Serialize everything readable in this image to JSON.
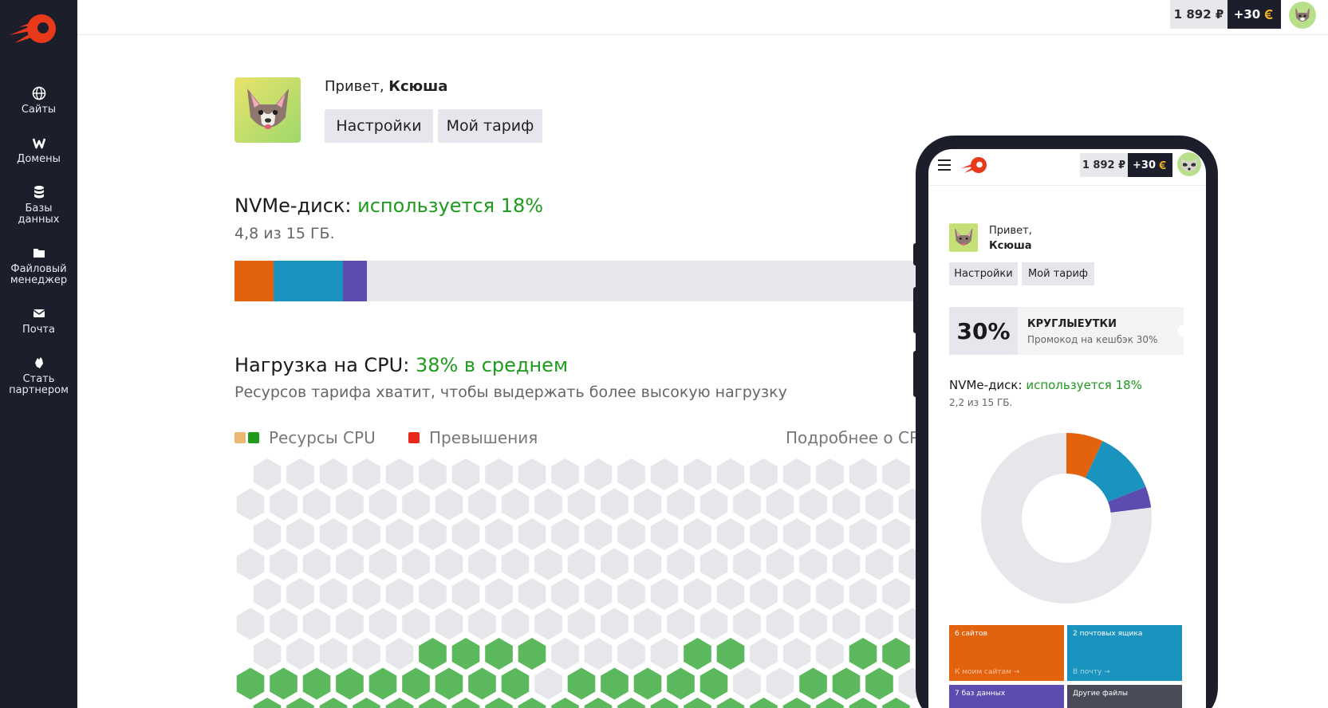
{
  "brand": {
    "accent": "#e8391b",
    "dark": "#1d1e2b",
    "green": "#1e9a1e"
  },
  "sidebar": {
    "items": [
      {
        "label": "Сайты",
        "icon": "globe-icon"
      },
      {
        "label": "Домены",
        "icon": "w-icon"
      },
      {
        "label": "Базы данных",
        "icon": "database-icon"
      },
      {
        "label": "Файловый менеджер",
        "icon": "folder-icon"
      },
      {
        "label": "Почта",
        "icon": "mail-icon"
      },
      {
        "label": "Стать партнером",
        "icon": "handshake-icon"
      }
    ]
  },
  "topbar": {
    "balance": "1 892 ₽",
    "bonus": "+30"
  },
  "greeting": {
    "prefix": "Привет,",
    "name": "Ксюша"
  },
  "buttons": {
    "settings": "Настройки",
    "tariff": "Мой тариф"
  },
  "disk": {
    "title": "NVMe-диск:",
    "status": "используется 18%",
    "detail": "4,8 из 15 ГБ.",
    "used_percent": 18,
    "segments": [
      {
        "color": "#e3620e",
        "fraction": 0.041
      },
      {
        "color": "#1a93be",
        "fraction": 0.072
      },
      {
        "color": "#5c4cb0",
        "fraction": 0.025
      }
    ],
    "track_color": "#e6e6eb"
  },
  "cpu": {
    "title": "Нагрузка на CPU:",
    "status": "38% в среднем",
    "detail": "Ресурсов тарифа хватит, чтобы выдержать более высокую нагрузку",
    "legend_resources": "Ресурсы CPU",
    "legend_exceed": "Превышения",
    "more_link": "Подробнее о CPU"
  },
  "phone": {
    "balance": "1 892 ₽",
    "bonus": "+30",
    "greeting_prefix": "Привет,",
    "greeting_name": "Ксюша",
    "settings": "Настройки",
    "tariff": "Мой тариф",
    "promo": {
      "value": "30%",
      "code": "КРУГЛЫЕУТКИ",
      "desc": "Промокод на кешбэк 30%"
    },
    "disk_title": "NVMe-диск:",
    "disk_status": "используется 18%",
    "disk_detail": "2,2 из 15 ГБ.",
    "donut_segments": [
      {
        "color": "#e3620e",
        "fraction": 0.07
      },
      {
        "color": "#1a93be",
        "fraction": 0.12
      },
      {
        "color": "#5c4cb0",
        "fraction": 0.04
      }
    ],
    "tiles": [
      {
        "title": "6 сайтов",
        "link": "К моим сайтам →",
        "color": "#e3620e"
      },
      {
        "title": "2 почтовых ящика",
        "link": "В почту →",
        "color": "#1a93be"
      },
      {
        "title": "7 баз данных",
        "link": "",
        "color": "#5c4cb0"
      },
      {
        "title": "Другие файлы",
        "link": "",
        "color": "#4a4b58"
      }
    ]
  }
}
